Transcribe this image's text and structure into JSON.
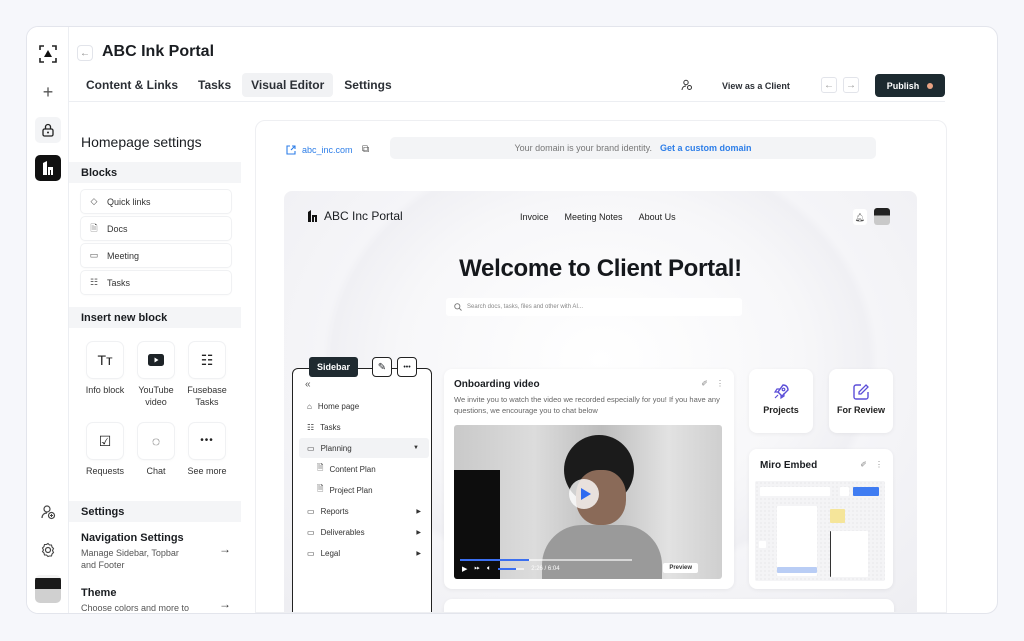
{
  "rail": {
    "icons": [
      "focus-logo-icon",
      "plus-icon",
      "lock-icon",
      "fusebase-logo-icon",
      "user-add-icon",
      "gear-icon",
      "avatar"
    ]
  },
  "header": {
    "back_icon": "←",
    "title": "ABC Ink Portal",
    "tabs": [
      {
        "label": "Content & Links",
        "active": false
      },
      {
        "label": "Tasks",
        "active": false
      },
      {
        "label": "Visual Editor",
        "active": true
      },
      {
        "label": "Settings",
        "active": false
      }
    ],
    "view_as_client": "View as a Client",
    "undo_icon": "←",
    "redo_icon": "→",
    "publish_label": "Publish",
    "publish_dot_color": "#e9a283"
  },
  "left_panel": {
    "title": "Homepage settings",
    "blocks_section": "Blocks",
    "blocks": [
      {
        "icon": "◇",
        "label": "Quick links"
      },
      {
        "icon": "🗎",
        "label": "Docs"
      },
      {
        "icon": "▭",
        "label": "Meeting"
      },
      {
        "icon": "☷",
        "label": "Tasks"
      }
    ],
    "insert_section": "Insert new block",
    "insert": [
      {
        "icon": "Tт",
        "label": "Info block"
      },
      {
        "icon": "▶",
        "label": "YouTube video"
      },
      {
        "icon": "☷",
        "label": "Fusebase Tasks"
      },
      {
        "icon": "☑",
        "label": "Requests"
      },
      {
        "icon": "◌",
        "label": "Chat"
      },
      {
        "icon": "•••",
        "label": "See more"
      }
    ],
    "settings_section": "Settings",
    "settings": [
      {
        "title": "Navigation Settings",
        "desc": "Manage Sidebar, Topbar and Footer",
        "arrow": "→"
      },
      {
        "title": "Theme",
        "desc": "Choose colors and more to",
        "arrow": "→"
      }
    ]
  },
  "domain": {
    "link": "abc_inc.com",
    "message": "Your domain is your brand identity.",
    "cta": "Get a custom domain"
  },
  "preview": {
    "logo_text": "ABC Inc Portal",
    "nav": [
      "Invoice",
      "Meeting Notes",
      "About Us"
    ],
    "heading": "Welcome to Client Portal!",
    "search_placeholder": "Search docs, tasks, files and other with AI...",
    "sidebar": {
      "tag": "Sidebar",
      "edit_icon": "✎",
      "more_icon": "•••",
      "collapse_icon": "«",
      "items": [
        {
          "icon": "⌂",
          "label": "Home page",
          "indent": false,
          "caret": ""
        },
        {
          "icon": "☷",
          "label": "Tasks",
          "indent": false,
          "caret": ""
        },
        {
          "icon": "▭",
          "label": "Planning",
          "indent": false,
          "caret": "▼",
          "selected": true
        },
        {
          "icon": "🗎",
          "label": "Content Plan",
          "indent": true,
          "caret": ""
        },
        {
          "icon": "🗎",
          "label": "Project Plan",
          "indent": true,
          "caret": ""
        },
        {
          "icon": "▭",
          "label": "Reports",
          "indent": false,
          "caret": "▶"
        },
        {
          "icon": "▭",
          "label": "Deliverables",
          "indent": false,
          "caret": "▶"
        },
        {
          "icon": "▭",
          "label": "Legal",
          "indent": false,
          "caret": "▶"
        }
      ]
    },
    "video_card": {
      "title": "Onboarding video",
      "description": "We invite you to watch the video we recorded especially for you! If you have any questions, we encourage you to chat below",
      "time": "2:26 / 6:04",
      "progress": 0.4,
      "volume": 0.7,
      "preview_label": "Preview"
    },
    "quick_tiles": [
      {
        "icon": "rocket-icon",
        "glyph": "🚀",
        "label": "Projects"
      },
      {
        "icon": "edit-square-icon",
        "glyph": "✎",
        "label": "For Review"
      }
    ],
    "miro_card": {
      "title": "Miro Embed"
    }
  }
}
